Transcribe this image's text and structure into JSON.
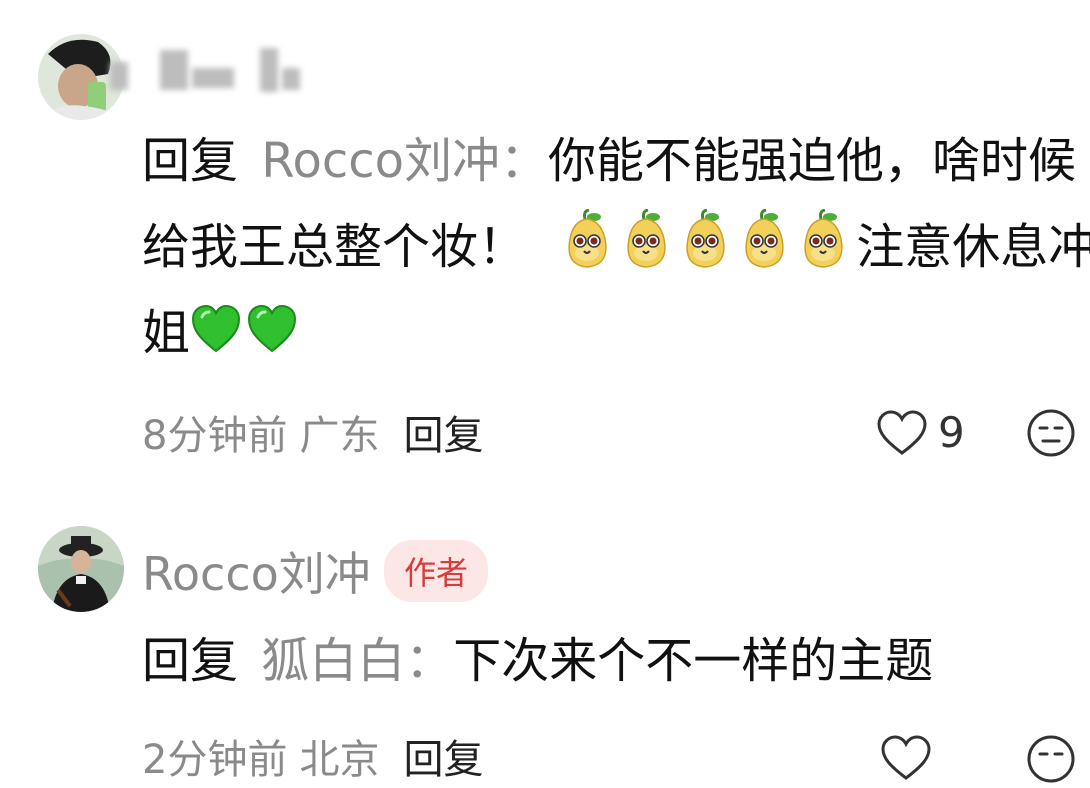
{
  "comments": [
    {
      "reply_label": "回复",
      "reply_to": "Rocco刘冲：",
      "line1": "你能不能强迫他，啥时候",
      "line2": "给我王总整个妆！",
      "line2_after_emoji": "注意休息冲",
      "line3": "姐",
      "emoji_pear": "pear-emoji",
      "emoji_heart": "green-heart-emoji",
      "time": "8分钟前",
      "location": "广东",
      "reply_button": "回复",
      "likes": "9"
    },
    {
      "author": "Rocco刘冲",
      "badge": "作者",
      "reply_label": "回复",
      "reply_to": "狐白白：",
      "text": "下次来个不一样的主题",
      "time": "2分钟前",
      "location": "北京",
      "reply_button": "回复"
    }
  ],
  "icons": {
    "like": "heart-outline-icon",
    "reaction": "neutral-face-icon"
  },
  "colors": {
    "badge_bg": "#fce6e6",
    "badge_text": "#d93a3a",
    "secondary_text": "#8a8a8a"
  }
}
